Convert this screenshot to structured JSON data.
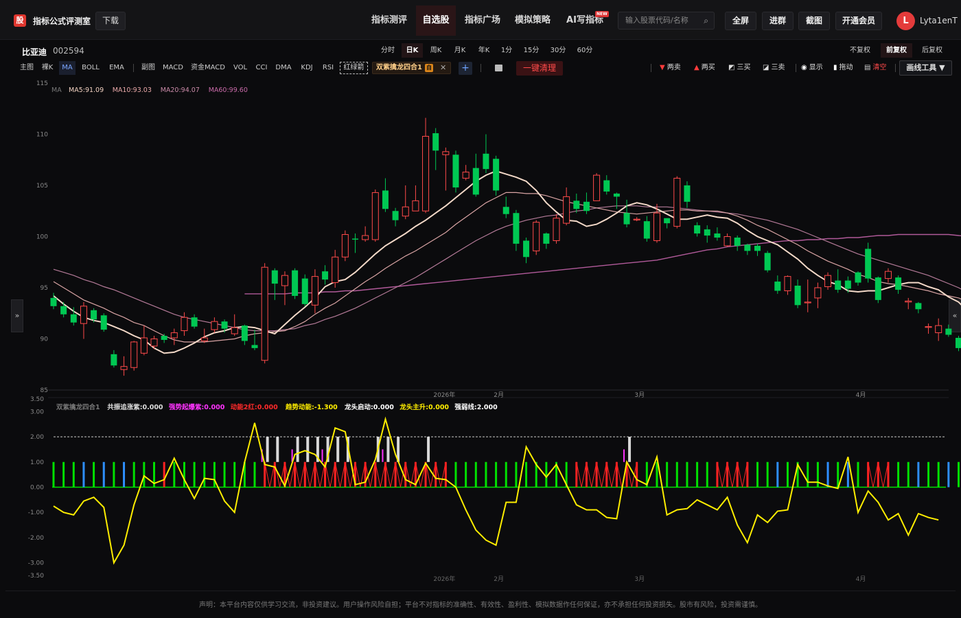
{
  "app": {
    "logo_text": "股",
    "brand": "指标公式评测室",
    "download": "下载",
    "nav": [
      "指标测评",
      "自选股",
      "指标广场",
      "模拟策略",
      "AI写指标"
    ],
    "nav_active": "自选股",
    "new_badge": "NEW",
    "search_placeholder": "输入股票代码/名称",
    "buttons": [
      "全屏",
      "进群",
      "截图",
      "开通会员"
    ],
    "avatar_letter": "L",
    "username": "Lyta1enT"
  },
  "stock": {
    "name": "比亚迪",
    "code": "002594",
    "periods": [
      "分时",
      "日K",
      "周K",
      "月K",
      "年K",
      "1分",
      "15分",
      "30分",
      "60分"
    ],
    "period_active": "日K",
    "adjust": [
      "不复权",
      "前复权",
      "后复权"
    ],
    "adjust_active": "前复权"
  },
  "indicators": {
    "main": [
      "主图",
      "裸K",
      "MA",
      "BOLL",
      "EMA"
    ],
    "main_active": "MA",
    "sub": [
      "副图",
      "MACD",
      "资金MACD",
      "VOL",
      "CCI",
      "DMA",
      "KDJ",
      "RSI"
    ],
    "dashed": "红绿箭",
    "chip_name": "双紫擒龙四合1",
    "chip_tag": "自",
    "clear": "一键清理",
    "draw_tools": [
      "两卖",
      "两买",
      "三买",
      "三卖",
      "显示",
      "拖动",
      "清空"
    ],
    "draw_menu": "画线工具 ▼"
  },
  "chart_data": [
    {
      "type": "candlestick",
      "title": "",
      "ma_legend": {
        "label": "MA",
        "items": [
          {
            "name": "MA5",
            "value": "91.09",
            "color": "#f0d0c0"
          },
          {
            "name": "MA10",
            "value": "93.03",
            "color": "#e8a8a8"
          },
          {
            "name": "MA20",
            "value": "94.07",
            "color": "#c98aa8"
          },
          {
            "name": "MA60",
            "value": "99.60",
            "color": "#c86aa8"
          }
        ]
      },
      "ylim": [
        85,
        115
      ],
      "y_ticks": [
        85,
        90,
        95,
        100,
        105,
        110,
        115
      ],
      "x_labels": [
        {
          "label": "2026年",
          "index": 39
        },
        {
          "label": "2月",
          "index": 45
        },
        {
          "label": "3月",
          "index": 59
        },
        {
          "label": "4月",
          "index": 81
        }
      ],
      "up_color": "#ff4a4a",
      "down_color": "#00c853",
      "candles": [
        [
          94.0,
          93.2,
          94.5,
          92.9
        ],
        [
          93.2,
          92.4,
          93.6,
          92.1
        ],
        [
          92.4,
          91.6,
          93.1,
          91.3
        ],
        [
          91.5,
          93.2,
          93.6,
          90.0
        ],
        [
          92.8,
          91.9,
          93.0,
          91.6
        ],
        [
          92.3,
          90.9,
          92.5,
          90.7
        ],
        [
          88.5,
          87.4,
          88.9,
          87.2
        ],
        [
          87.0,
          87.3,
          88.3,
          86.4
        ],
        [
          87.2,
          89.7,
          89.8,
          86.9
        ],
        [
          88.6,
          90.1,
          91.3,
          88.4
        ],
        [
          89.3,
          90.0,
          90.3,
          89.0
        ],
        [
          90.3,
          89.9,
          90.5,
          89.6
        ],
        [
          90.1,
          90.6,
          91.0,
          89.4
        ],
        [
          90.8,
          92.1,
          92.6,
          90.3
        ],
        [
          92.1,
          91.2,
          92.4,
          91.0
        ],
        [
          89.8,
          90.1,
          91.0,
          89.6
        ],
        [
          90.9,
          91.7,
          92.1,
          90.6
        ],
        [
          91.7,
          91.0,
          91.9,
          90.6
        ],
        [
          90.5,
          91.1,
          92.4,
          90.3
        ],
        [
          91.3,
          89.8,
          91.4,
          89.4
        ],
        [
          89.4,
          89.1,
          90.9,
          88.9
        ],
        [
          87.9,
          97.0,
          97.4,
          87.6
        ],
        [
          96.7,
          95.4,
          96.9,
          93.8
        ],
        [
          95.2,
          96.2,
          96.6,
          93.3
        ],
        [
          96.7,
          94.2,
          96.9,
          93.9
        ],
        [
          95.9,
          93.4,
          96.3,
          93.2
        ],
        [
          93.3,
          96.1,
          96.8,
          92.5
        ],
        [
          96.6,
          95.8,
          97.2,
          95.3
        ],
        [
          95.5,
          98.0,
          98.7,
          95.0
        ],
        [
          98.0,
          100.2,
          100.6,
          97.6
        ],
        [
          99.8,
          99.7,
          100.3,
          98.4
        ],
        [
          99.7,
          100.1,
          101.0,
          99.5
        ],
        [
          99.7,
          104.3,
          104.6,
          99.5
        ],
        [
          104.5,
          102.7,
          105.7,
          102.4
        ],
        [
          102.5,
          101.6,
          102.8,
          101.0
        ],
        [
          102.0,
          102.9,
          105.0,
          101.7
        ],
        [
          102.5,
          103.5,
          105.0,
          102.5
        ],
        [
          102.5,
          109.8,
          111.6,
          102.3
        ],
        [
          110.1,
          108.4,
          110.6,
          106.5
        ],
        [
          108.0,
          108.3,
          108.7,
          104.5
        ],
        [
          108.0,
          104.8,
          108.4,
          104.3
        ],
        [
          105.7,
          106.3,
          107.0,
          105.5
        ],
        [
          106.7,
          104.1,
          108.1,
          103.9
        ],
        [
          108.1,
          106.6,
          110.0,
          106.2
        ],
        [
          107.6,
          104.5,
          107.9,
          104.0
        ],
        [
          102.9,
          102.2,
          103.9,
          101.8
        ],
        [
          102.3,
          99.3,
          102.6,
          98.6
        ],
        [
          99.6,
          98.0,
          99.9,
          97.4
        ],
        [
          98.6,
          101.4,
          101.6,
          98.2
        ],
        [
          100.3,
          99.3,
          100.4,
          98.8
        ],
        [
          99.6,
          101.8,
          102.2,
          99.3
        ],
        [
          101.3,
          103.9,
          104.8,
          101.1
        ],
        [
          103.5,
          102.7,
          104.2,
          102.3
        ],
        [
          103.4,
          102.5,
          104.3,
          102.2
        ],
        [
          103.5,
          106.0,
          106.2,
          103.5
        ],
        [
          105.5,
          104.4,
          106.0,
          104.1
        ],
        [
          104.2,
          103.9,
          104.3,
          102.7
        ],
        [
          102.3,
          101.2,
          103.6,
          100.9
        ],
        [
          101.7,
          101.7,
          101.9,
          101.5
        ],
        [
          101.5,
          99.8,
          102.0,
          99.5
        ],
        [
          99.6,
          102.3,
          103.2,
          99.4
        ],
        [
          101.8,
          101.3,
          101.8,
          100.8
        ],
        [
          101.0,
          105.7,
          105.9,
          100.8
        ],
        [
          105.0,
          103.4,
          105.4,
          102.8
        ],
        [
          101.1,
          100.3,
          101.4,
          100.0
        ],
        [
          100.7,
          100.1,
          101.1,
          99.4
        ],
        [
          100.3,
          99.9,
          100.9,
          99.6
        ],
        [
          99.1,
          100.0,
          100.3,
          99.0
        ],
        [
          99.9,
          99.1,
          100.1,
          98.6
        ],
        [
          99.2,
          98.6,
          99.3,
          98.2
        ],
        [
          99.1,
          98.6,
          99.3,
          98.1
        ],
        [
          98.4,
          96.7,
          98.6,
          96.5
        ],
        [
          95.6,
          94.7,
          96.2,
          94.4
        ],
        [
          94.7,
          96.1,
          96.2,
          94.3
        ],
        [
          95.2,
          93.3,
          95.8,
          93.0
        ],
        [
          93.6,
          93.6,
          95.8,
          92.6
        ],
        [
          94.0,
          95.0,
          95.5,
          93.0
        ],
        [
          95.1,
          96.2,
          96.5,
          94.8
        ],
        [
          95.7,
          94.8,
          96.8,
          94.5
        ],
        [
          95.7,
          94.9,
          96.1,
          94.5
        ],
        [
          96.5,
          95.5,
          96.6,
          95.2
        ],
        [
          98.8,
          95.9,
          99.4,
          95.5
        ],
        [
          96.0,
          93.8,
          96.1,
          93.5
        ],
        [
          95.9,
          96.6,
          96.9,
          95.5
        ],
        [
          96.0,
          94.8,
          96.2,
          94.4
        ],
        [
          93.6,
          93.7,
          94.0,
          92.9
        ],
        [
          93.5,
          92.9,
          93.6,
          92.5
        ],
        [
          91.2,
          91.2,
          91.5,
          90.5
        ],
        [
          90.6,
          91.3,
          92.0,
          89.8
        ],
        [
          91.0,
          90.4,
          91.4,
          90.2
        ],
        [
          90.1,
          89.1,
          90.3,
          88.8
        ]
      ],
      "ma5": [
        94.2,
        93.4,
        92.7,
        92.1,
        91.8,
        91.6,
        91.2,
        90.8,
        90.3,
        89.9,
        89.1,
        88.6,
        88.7,
        89.1,
        89.6,
        90.2,
        90.6,
        90.8,
        91.1,
        91.2,
        91.1,
        90.8,
        90.5,
        91.4,
        92.3,
        93.1,
        94.0,
        95.1,
        95.6,
        95.8,
        96.5,
        97.4,
        98.3,
        99.1,
        99.7,
        100.3,
        101.0,
        101.6,
        102.3,
        103.0,
        103.8,
        104.6,
        105.4,
        106.0,
        106.4,
        106.1,
        105.8,
        105.4,
        104.5,
        103.3,
        102.4,
        101.6,
        101.5,
        101.0,
        101.2,
        101.7,
        102.3,
        103.0,
        103.3,
        103.1,
        102.7,
        102.2,
        101.7,
        101.7,
        101.9,
        102.1,
        101.9,
        101.8,
        101.3,
        100.6,
        100.0,
        99.6,
        99.2,
        98.5,
        97.8,
        96.9,
        96.2,
        95.6,
        95.3,
        94.7,
        94.6,
        94.7,
        94.7,
        95.0,
        95.3,
        95.5,
        95.5,
        95.1,
        94.8,
        94.1,
        93.6,
        92.6
      ],
      "ma10": [
        95.6,
        95.0,
        94.4,
        93.8,
        93.4,
        93.0,
        92.5,
        92.1,
        91.6,
        91.3,
        90.8,
        90.3,
        89.9,
        89.7,
        89.7,
        89.7,
        89.8,
        89.9,
        90.0,
        90.3,
        90.5,
        90.6,
        90.7,
        90.8,
        91.2,
        91.7,
        92.4,
        93.0,
        93.5,
        94.2,
        94.9,
        95.6,
        96.2,
        96.9,
        97.5,
        98.1,
        98.6,
        99.2,
        99.8,
        100.4,
        101.2,
        101.9,
        102.6,
        103.3,
        103.8,
        104.3,
        104.3,
        104.2,
        104.2,
        104.0,
        103.7,
        103.4,
        103.2,
        103.0,
        102.8,
        102.6,
        102.4,
        102.3,
        102.2,
        102.3,
        102.4,
        102.5,
        102.6,
        102.6,
        102.5,
        102.5,
        102.5,
        102.3,
        102.0,
        101.6,
        101.1,
        100.7,
        100.2,
        99.7,
        99.2,
        98.6,
        98.1,
        97.6,
        97.2,
        96.8,
        96.3,
        96.0,
        95.6,
        95.4,
        95.3,
        95.1,
        94.9,
        94.7,
        94.4,
        94.2,
        94.0,
        93.6
      ],
      "ma20": [
        96.8,
        96.5,
        96.2,
        95.8,
        95.5,
        95.1,
        94.8,
        94.4,
        94.0,
        93.6,
        93.2,
        92.8,
        92.4,
        92.1,
        91.9,
        91.7,
        91.5,
        91.3,
        91.1,
        90.9,
        90.8,
        90.8,
        90.8,
        90.9,
        91.0,
        91.3,
        91.5,
        91.9,
        92.2,
        92.6,
        93.0,
        93.5,
        94.0,
        94.5,
        95.0,
        95.5,
        96.0,
        96.6,
        97.2,
        97.8,
        98.4,
        99.0,
        99.6,
        100.1,
        100.6,
        101.0,
        101.3,
        101.6,
        101.8,
        102.0,
        102.1,
        102.3,
        102.5,
        102.6,
        102.8,
        102.9,
        103.0,
        103.0,
        103.0,
        102.9,
        102.9,
        102.9,
        102.8,
        102.7,
        102.6,
        102.5,
        102.4,
        102.3,
        102.2,
        102.0,
        101.8,
        101.6,
        101.3,
        101.0,
        100.7,
        100.3,
        99.9,
        99.5,
        99.1,
        98.7,
        98.3,
        98.0,
        97.7,
        97.4,
        97.1,
        96.8,
        96.5,
        96.2,
        95.8,
        95.4,
        95.0,
        94.5
      ],
      "ma60_start": 19,
      "ma60": [
        94.4,
        94.4,
        94.4,
        94.4,
        94.4,
        94.5,
        94.5,
        94.5,
        94.6,
        94.6,
        94.7,
        94.7,
        94.8,
        94.9,
        95.0,
        95.1,
        95.2,
        95.3,
        95.4,
        95.5,
        95.6,
        95.7,
        95.8,
        95.9,
        96.0,
        96.1,
        96.2,
        96.3,
        96.4,
        96.5,
        96.6,
        96.7,
        96.8,
        96.9,
        97.0,
        97.1,
        97.2,
        97.3,
        97.4,
        97.5,
        97.6,
        97.7,
        97.9,
        98.1,
        98.3,
        98.5,
        98.7,
        98.8,
        99.0,
        99.1,
        99.2,
        99.3,
        99.4,
        99.5,
        99.6,
        99.6,
        99.7,
        99.7,
        99.8,
        99.8,
        99.9,
        99.9,
        100.0,
        100.1,
        100.1,
        100.2,
        100.2,
        100.2,
        100.2,
        100.2,
        100.2,
        100.1,
        100.0,
        99.8
      ]
    },
    {
      "type": "mixed",
      "title": "",
      "legend": [
        {
          "name": "双紫擒龙四合1",
          "value": "",
          "color": "#777777"
        },
        {
          "name": "共振追涨紫",
          "value": "0.000",
          "color": "#dddddd"
        },
        {
          "name": "强势起爆紫",
          "value": "0.000",
          "color": "#ff33ff"
        },
        {
          "name": "动能2红",
          "value": "0.000",
          "color": "#ff2a2a"
        },
        {
          "name": "趋势动能",
          "value": "-1.300",
          "color": "#ffee00"
        },
        {
          "name": "龙头启动",
          "value": "0.000",
          "color": "#ffffff"
        },
        {
          "name": "龙头主升",
          "value": "0.000",
          "color": "#ffee00"
        },
        {
          "name": "强弱线",
          "value": "2.000",
          "color": "#ffffff"
        }
      ],
      "ylim": [
        -3.5,
        3.5
      ],
      "y_ticks": [
        3.5,
        3.0,
        2.0,
        1.0,
        0.0,
        -1.0,
        -2.0,
        -3.0,
        -3.5
      ],
      "dashed_level": 2.0,
      "trend_line": [
        -0.75,
        -1.0,
        -1.1,
        -0.55,
        -0.4,
        -0.8,
        -3.0,
        -2.3,
        -0.7,
        0.45,
        0.15,
        0.3,
        1.15,
        0.3,
        -0.45,
        0.35,
        0.3,
        -0.55,
        -1.0,
        1.0,
        2.55,
        0.9,
        0.8,
        0.05,
        1.3,
        1.45,
        1.3,
        0.8,
        2.35,
        2.2,
        0.1,
        0.2,
        1.1,
        2.7,
        1.3,
        0.3,
        0.1,
        0.95,
        0.35,
        0.3,
        0.0,
        -0.9,
        -1.7,
        -2.1,
        -2.3,
        -0.6,
        -0.6,
        1.6,
        0.9,
        0.4,
        0.9,
        0.1,
        -0.7,
        -0.9,
        -0.9,
        -1.2,
        -1.25,
        1.0,
        0.3,
        0.1,
        1.2,
        -1.1,
        -0.9,
        -0.85,
        -0.5,
        -0.7,
        -0.9,
        -0.4,
        -1.5,
        -2.2,
        -1.1,
        -1.4,
        -0.95,
        -0.9,
        0.9,
        0.2,
        0.2,
        0.05,
        -0.05,
        1.2,
        -1.0,
        -0.15,
        -0.6,
        -1.3,
        -1.05,
        -1.9,
        -1.05,
        -1.2,
        -1.3
      ],
      "bars": [
        {
          "value": 1.0,
          "colors": "gggbgbgbgggrgggggggggrrrrrrrrrrrrrrrrrrrggggggggggggrrrrrrrgggggggrrrrggbggggbgbgrrrggbggbgg"
        }
      ]
    }
  ],
  "footer": "声明：本平台内容仅供学习交流，非投资建议。用户操作风险自担；平台不对指标的准确性、有效性、盈利性、模拟数据作任何保证，亦不承担任何投资损失。股市有风险，投资需谨慎。"
}
